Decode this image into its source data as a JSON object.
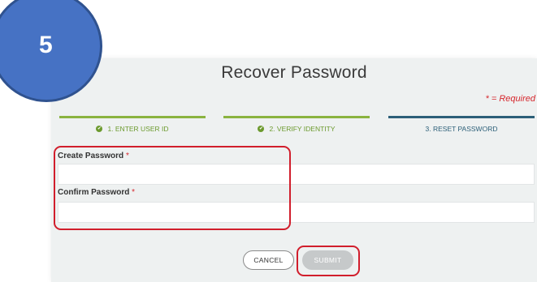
{
  "badge": {
    "number": "5"
  },
  "dialog": {
    "title": "Recover Password",
    "required_note": "* = Required"
  },
  "steps": [
    {
      "label": "1. ENTER USER ID",
      "status": "complete"
    },
    {
      "label": "2. VERIFY IDENTITY",
      "status": "complete"
    },
    {
      "label": "3. RESET PASSWORD",
      "status": "current"
    }
  ],
  "fields": {
    "create_password": {
      "label": "Create Password",
      "required_mark": "*",
      "value": ""
    },
    "confirm_password": {
      "label": "Confirm Password",
      "required_mark": "*",
      "value": ""
    }
  },
  "buttons": {
    "cancel": "CANCEL",
    "submit": "SUBMIT"
  },
  "colors": {
    "complete_step": "#8ab33f",
    "current_step": "#2c5f78",
    "required": "#d6282e",
    "annotation": "#d11e2c",
    "badge": "#4672c4"
  }
}
